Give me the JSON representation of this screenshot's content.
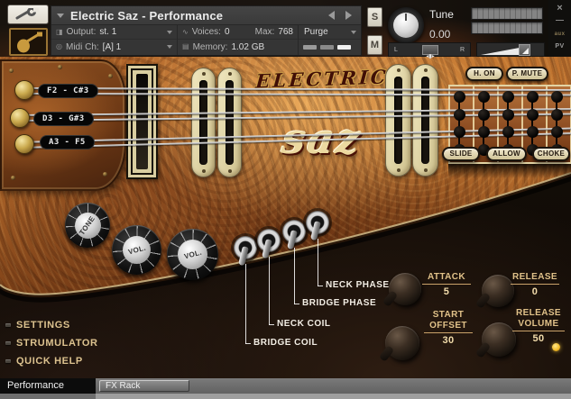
{
  "window": {
    "close": "×",
    "minimize": "—",
    "aux": "aux",
    "pv": "PV"
  },
  "header": {
    "title": "Electric Saz - Performance",
    "output_label": "Output:",
    "output_value": "st. 1",
    "midi_label": "Midi Ch:",
    "midi_value": "[A] 1",
    "voices_label": "Voices:",
    "voices_value": "0",
    "max_label": "Max:",
    "max_value": "768",
    "memory_label": "Memory:",
    "memory_value": "1.02 GB",
    "purge_label": "Purge",
    "solo": "S",
    "mute": "M",
    "tune_label": "Tune",
    "tune_value": "0.00",
    "pan_left": "L",
    "pan_right": "R"
  },
  "instrument": {
    "logo_top": "ELECTRIC",
    "logo_main": "saz",
    "string_ranges": [
      "F2 - C#3",
      "D3 - G#3",
      "A3 - F5"
    ],
    "articulation_buttons_top": [
      "H. ON",
      "P. MUTE"
    ],
    "articulation_buttons_bottom": [
      "SLIDE",
      "ALLOW",
      "CHOKE"
    ],
    "knob_caps": [
      "TONE",
      "VOL.",
      "VOL."
    ],
    "switch_labels": [
      "BRIDGE COIL",
      "NECK COIL",
      "BRIDGE PHASE",
      "NECK PHASE"
    ],
    "envelope": [
      {
        "line1": "ATTACK",
        "line2": "",
        "value": "5"
      },
      {
        "line1": "RELEASE",
        "line2": "",
        "value": "0"
      },
      {
        "line1": "START",
        "line2": "OFFSET",
        "value": "30"
      },
      {
        "line1": "RELEASE",
        "line2": "VOLUME",
        "value": "50"
      }
    ],
    "menu": [
      "SETTINGS",
      "STRUMULATOR",
      "QUICK HELP"
    ]
  },
  "tabs": {
    "performance": "Performance",
    "fx_rack": "FX Rack"
  },
  "colors": {
    "led_yellow": "#f5c842",
    "label_tan": "#e0c189",
    "wood_accent": "#b96f2e"
  }
}
